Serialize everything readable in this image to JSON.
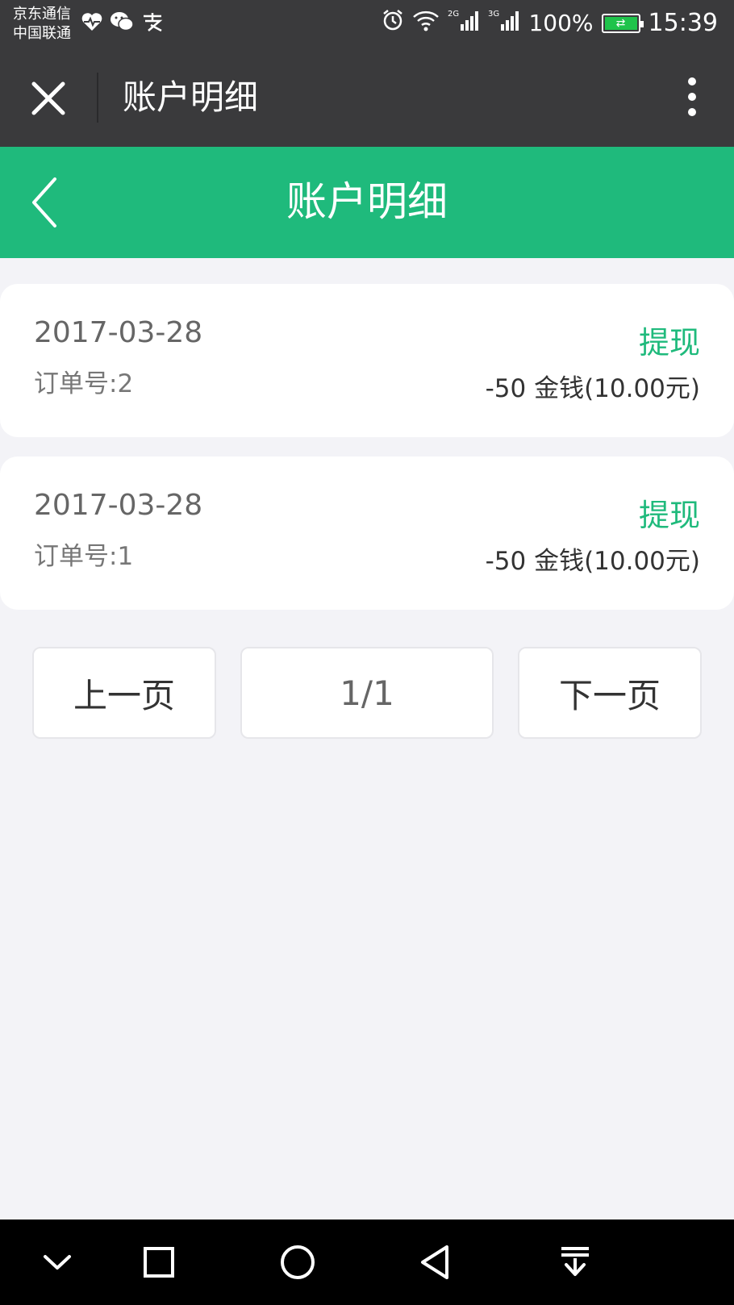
{
  "status_bar": {
    "carrier_1": "京东通信",
    "carrier_2": "中国联通",
    "left_icons": [
      "heart-pulse-icon",
      "wechat-icon",
      "alipay-icon"
    ],
    "network_1": "2G",
    "network_2": "3G",
    "battery": "100%",
    "time": "15:39"
  },
  "wechat_bar": {
    "title": "账户明细"
  },
  "header": {
    "title": "账户明细"
  },
  "records": [
    {
      "date": "2017-03-28",
      "order": "订单号:2",
      "type": "提现",
      "amount": "-50 金钱(10.00元)"
    },
    {
      "date": "2017-03-28",
      "order": "订单号:1",
      "type": "提现",
      "amount": "-50 金钱(10.00元)"
    }
  ],
  "pagination": {
    "prev": "上一页",
    "info": "1/1",
    "next": "下一页"
  },
  "nav": [
    "chevron-down-icon",
    "square-icon",
    "circle-icon",
    "triangle-back-icon",
    "download-icon"
  ],
  "colors": {
    "accent": "#1fba7c",
    "dark_bar": "#3a3a3c",
    "background": "#f3f3f7"
  }
}
